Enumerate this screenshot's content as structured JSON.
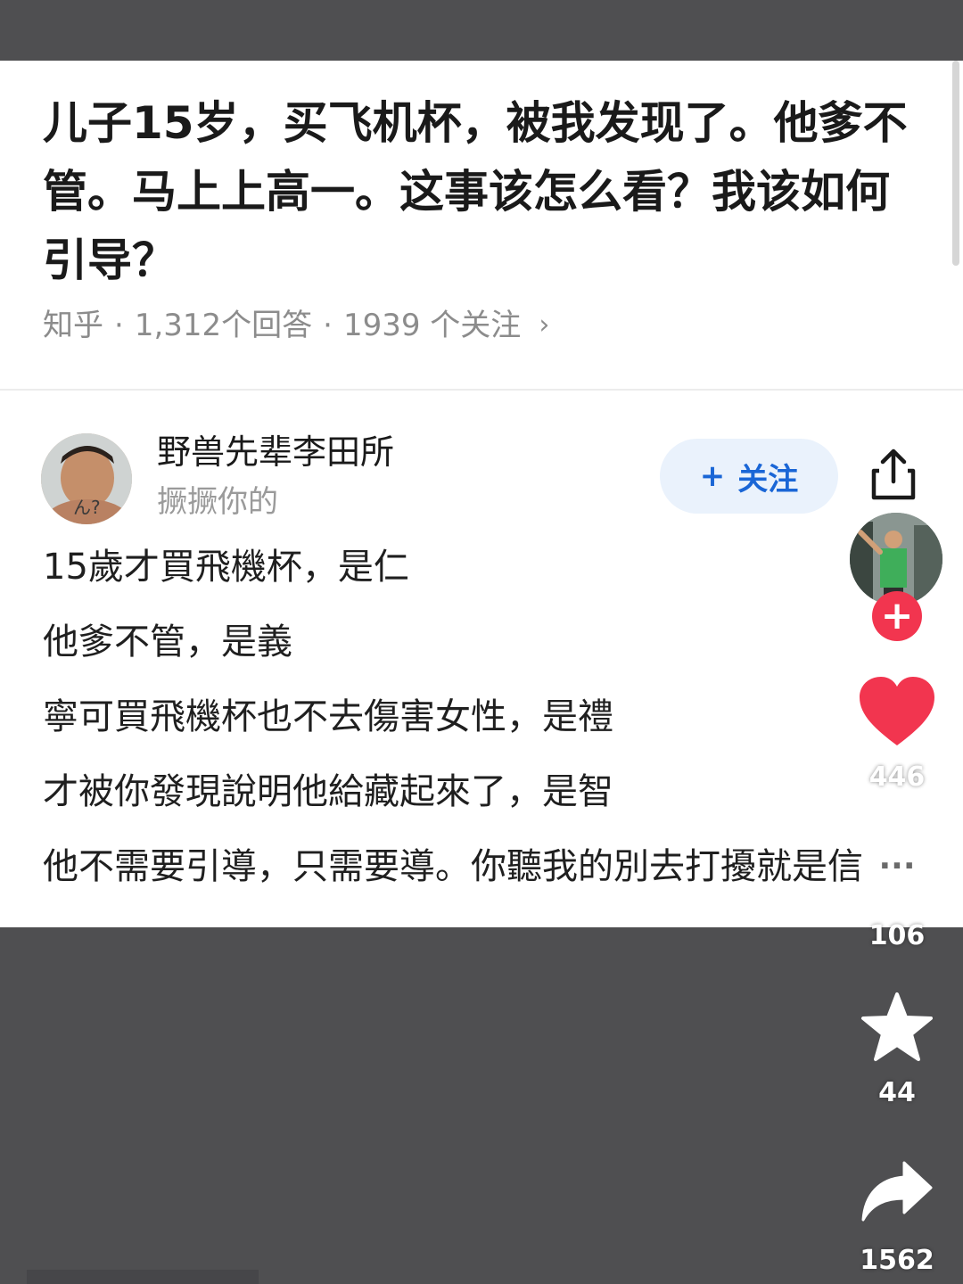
{
  "question": {
    "title": "儿子15岁，买飞机杯，被我发现了。他爹不管。马上上高一。这事该怎么看？我该如何引导？",
    "source": "知乎",
    "answers": "1,312个回答",
    "followers": "1939 个关注",
    "chevron": "›"
  },
  "author": {
    "name": "野兽先辈李田所",
    "bio": "撅撅你的",
    "avatar_icon": "user-avatar",
    "avatar_tag": "ん?"
  },
  "follow_button": {
    "plus": "+",
    "label": "关注",
    "bg": "#eaf2fc",
    "color": "#1a66d6"
  },
  "answer": {
    "lines": [
      "15歲才買飛機杯，是仁",
      "他爹不管，是義",
      "寧可買飛機杯也不去傷害女性，是禮",
      "才被你發現說明他給藏起來了，是智",
      "他不需要引導，只需要導。你聽我的別去打擾就是信"
    ]
  },
  "rail": {
    "share_icon": "share-upload-icon",
    "creator_plus": "+",
    "like_count": "446",
    "like_color": "#f2354f",
    "comment_dots": "···",
    "comment_count": "106",
    "favorite_count": "44",
    "forward_count": "1562"
  },
  "colors": {
    "backdrop": "#4f4f51",
    "card": "#ffffff",
    "meta_gray": "#8c8c8c"
  }
}
